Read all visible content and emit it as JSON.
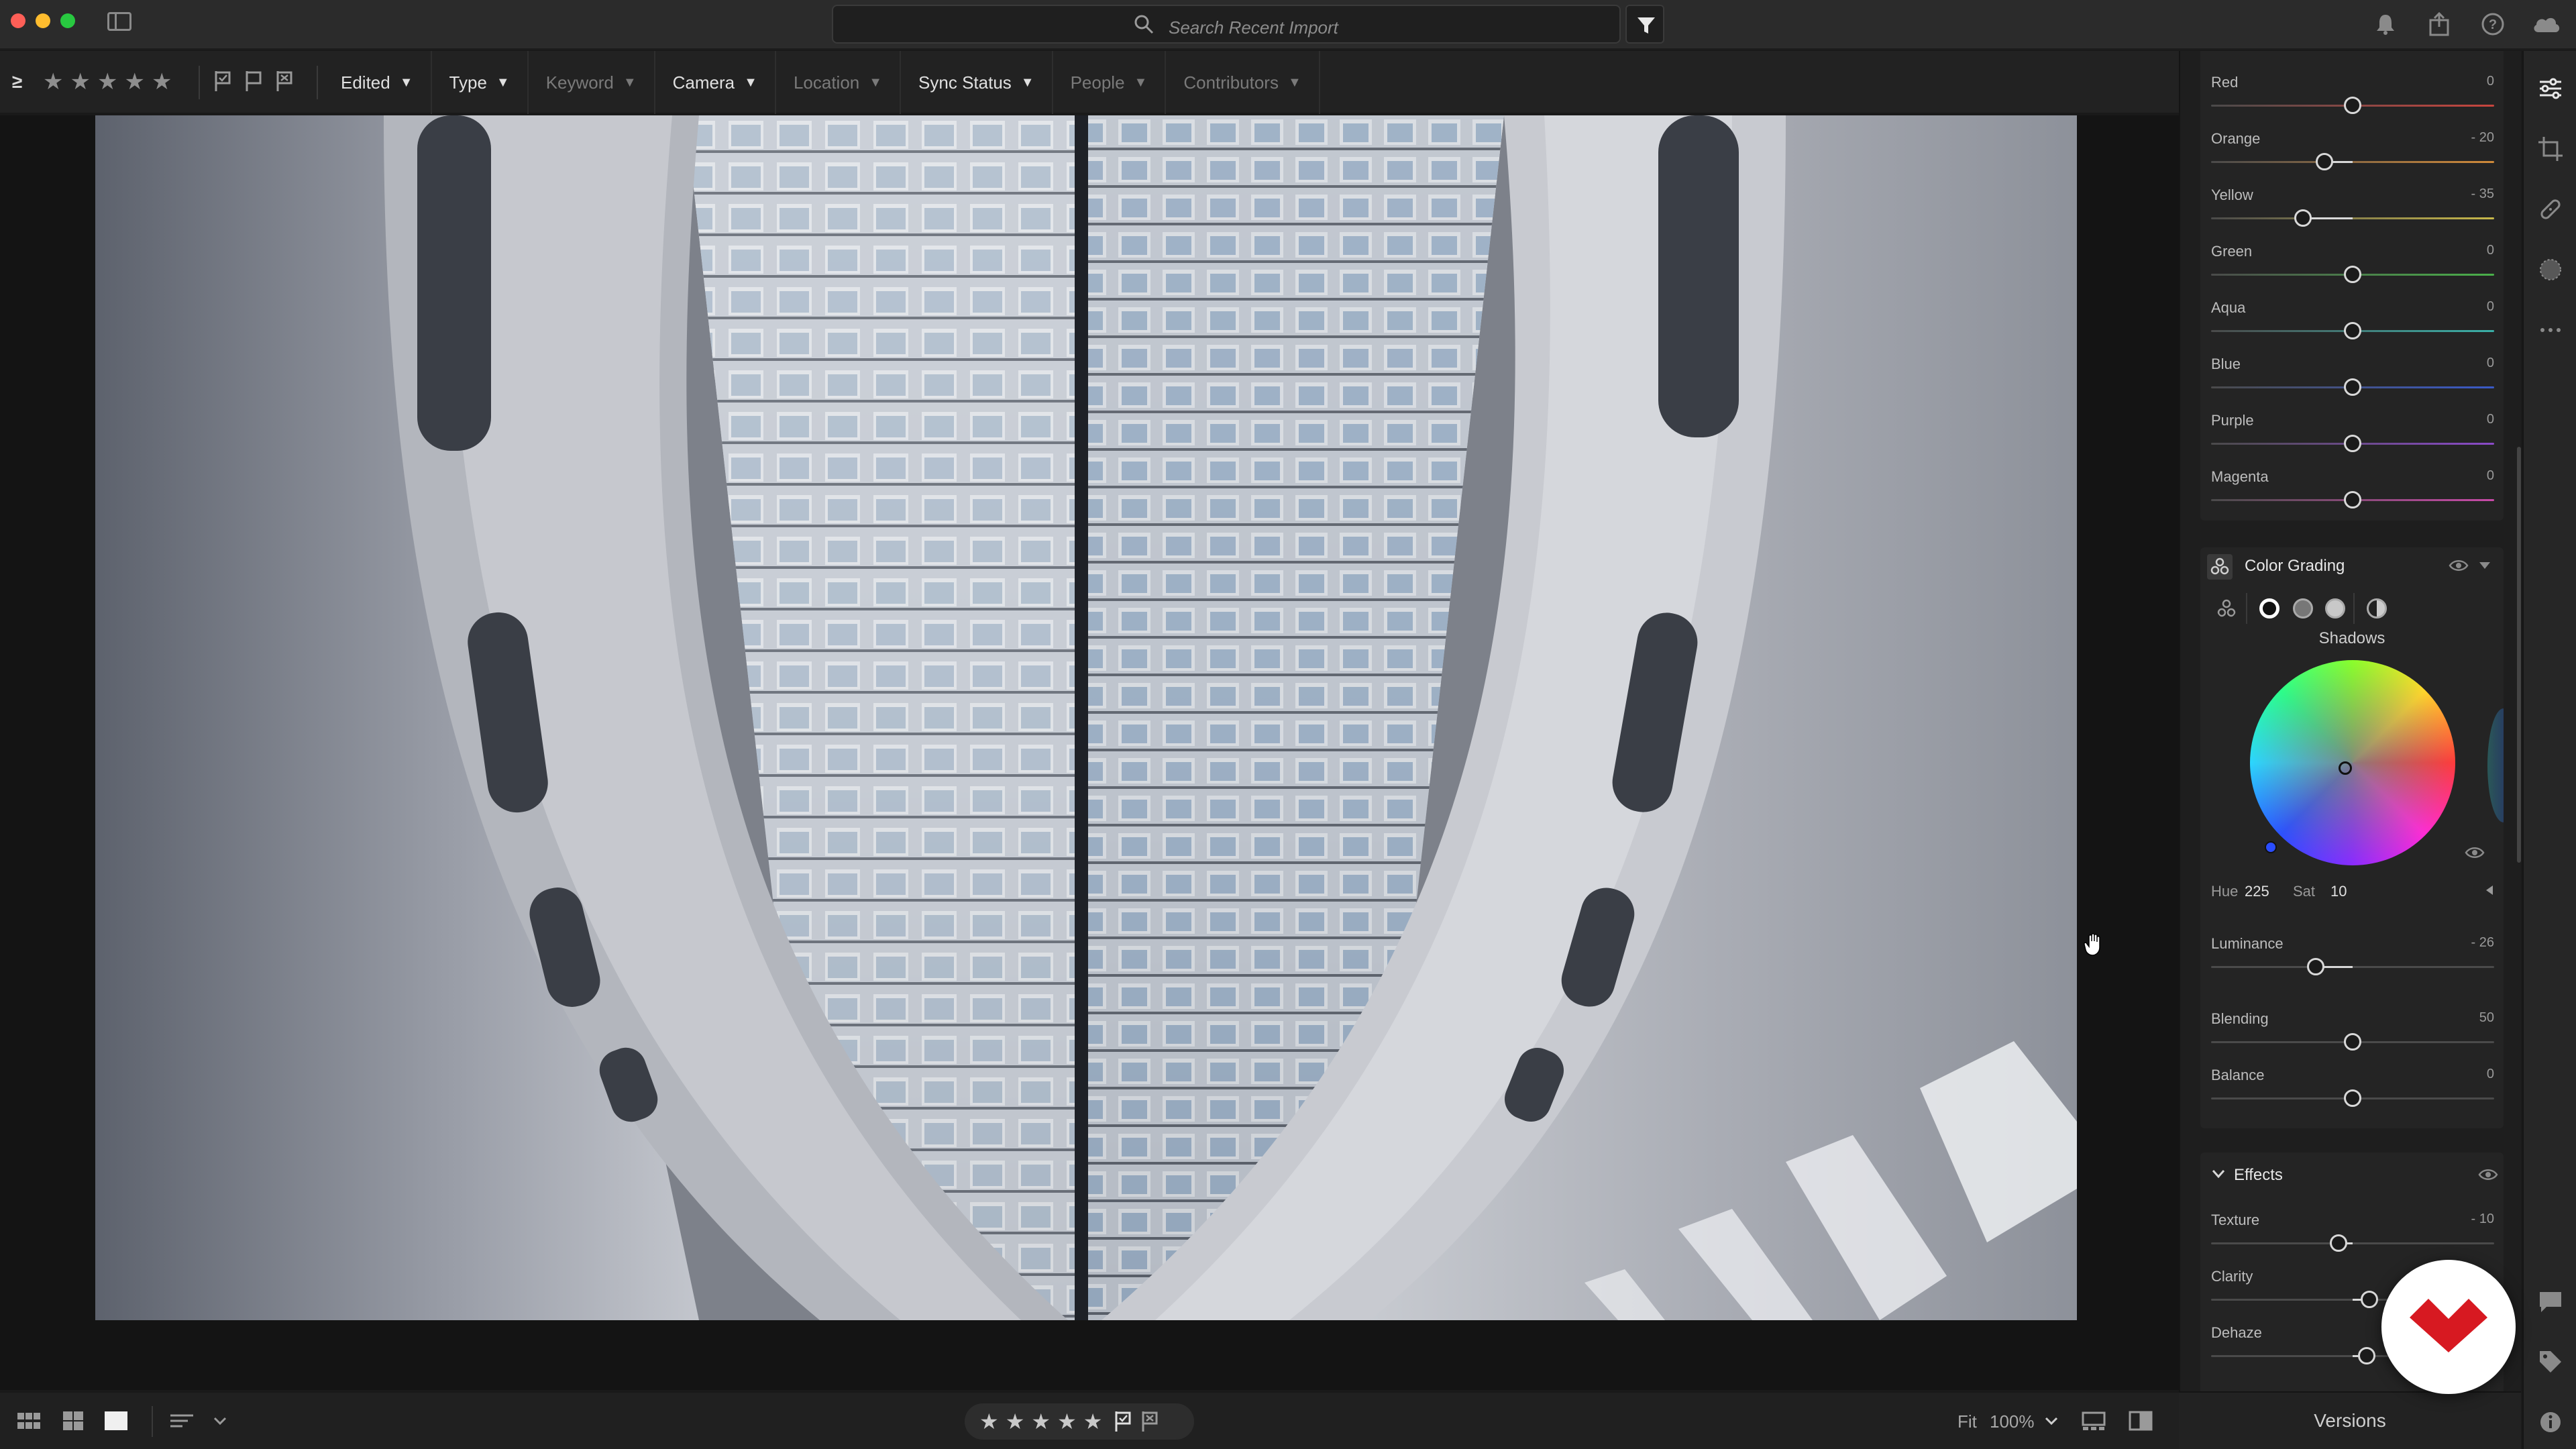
{
  "titlebar": {
    "search_placeholder": "Search Recent Import"
  },
  "filterbar": {
    "panel_toggle": "≥",
    "stars": [
      "★",
      "★",
      "★",
      "★",
      "★"
    ],
    "dropdowns": [
      {
        "label": "Edited",
        "enabled": true
      },
      {
        "label": "Type",
        "enabled": true
      },
      {
        "label": "Keyword",
        "enabled": false
      },
      {
        "label": "Camera",
        "enabled": true
      },
      {
        "label": "Location",
        "enabled": false
      },
      {
        "label": "Sync Status",
        "enabled": true
      },
      {
        "label": "People",
        "enabled": false
      },
      {
        "label": "Contributors",
        "enabled": false
      }
    ]
  },
  "hsl": {
    "rows": [
      {
        "label": "Red",
        "value": "0",
        "position": 0.5,
        "color": "#c8453e"
      },
      {
        "label": "Orange",
        "value": "- 20",
        "position": 0.4,
        "color": "#d08a3a"
      },
      {
        "label": "Yellow",
        "value": "- 35",
        "position": 0.325,
        "color": "#c8b84a"
      },
      {
        "label": "Green",
        "value": "0",
        "position": 0.5,
        "color": "#4ab04a"
      },
      {
        "label": "Aqua",
        "value": "0",
        "position": 0.5,
        "color": "#3ab0a8"
      },
      {
        "label": "Blue",
        "value": "0",
        "position": 0.5,
        "color": "#3a5ac8"
      },
      {
        "label": "Purple",
        "value": "0",
        "position": 0.5,
        "color": "#8a4ac8"
      },
      {
        "label": "Magenta",
        "value": "0",
        "position": 0.5,
        "color": "#c84aa8"
      }
    ]
  },
  "color_grading": {
    "title": "Color Grading",
    "active_region": "Shadows",
    "hue_label": "Hue",
    "hue_value": "225",
    "sat_label": "Sat",
    "sat_value": "10",
    "sliders": [
      {
        "label": "Luminance",
        "value": "- 26",
        "position": 0.37
      },
      {
        "label": "Blending",
        "value": "50",
        "position": 0.5
      },
      {
        "label": "Balance",
        "value": "0",
        "position": 0.5
      }
    ]
  },
  "effects": {
    "title": "Effects",
    "sliders": [
      {
        "label": "Texture",
        "value": "- 10",
        "position": 0.45
      },
      {
        "label": "Clarity",
        "value": "",
        "position": 0.56
      },
      {
        "label": "Dehaze",
        "value": "",
        "position": 0.55
      }
    ]
  },
  "bottombar": {
    "fit_label": "Fit",
    "zoom_label": "100%",
    "rating_stars": [
      "★",
      "★",
      "★",
      "★",
      "★"
    ]
  },
  "versions_label": "Versions"
}
